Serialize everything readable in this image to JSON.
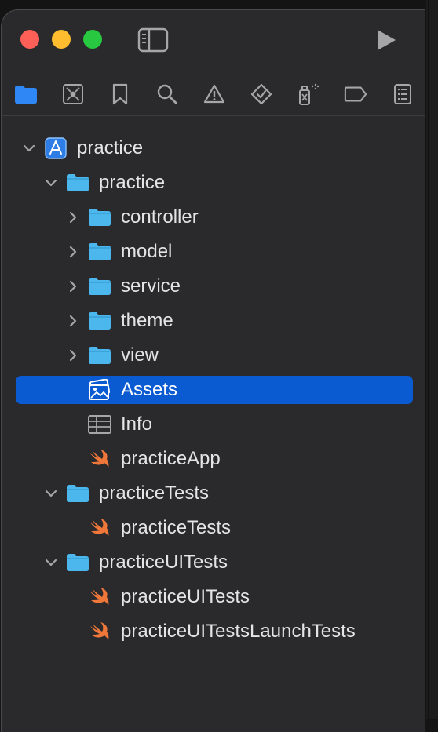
{
  "colors": {
    "accent": "#0a5ad1",
    "folder": "#4bb7ec",
    "swift": "#f0773a",
    "text": "#e4e4e6",
    "icon": "#a6a6a8",
    "close": "#fe5f57",
    "minimize": "#febc2e",
    "zoom": "#28c840"
  },
  "titlebar": {
    "icons": [
      "sidebar-toggle-icon",
      "run-play-icon"
    ]
  },
  "navigator_tabs": [
    {
      "icon": "folder-icon",
      "active": true
    },
    {
      "icon": "source-control-icon"
    },
    {
      "icon": "bookmark-icon"
    },
    {
      "icon": "search-icon"
    },
    {
      "icon": "warning-icon"
    },
    {
      "icon": "test-diamond-icon"
    },
    {
      "icon": "debug-spray-icon"
    },
    {
      "icon": "breakpoint-tag-icon"
    },
    {
      "icon": "report-list-icon"
    }
  ],
  "tree": [
    {
      "label": "practice",
      "type": "project",
      "depth": 0,
      "expanded": true
    },
    {
      "label": "practice",
      "type": "folder",
      "depth": 1,
      "expanded": true
    },
    {
      "label": "controller",
      "type": "folder",
      "depth": 2,
      "expanded": false
    },
    {
      "label": "model",
      "type": "folder",
      "depth": 2,
      "expanded": false
    },
    {
      "label": "service",
      "type": "folder",
      "depth": 2,
      "expanded": false
    },
    {
      "label": "theme",
      "type": "folder",
      "depth": 2,
      "expanded": false
    },
    {
      "label": "view",
      "type": "folder",
      "depth": 2,
      "expanded": false
    },
    {
      "label": "Assets",
      "type": "assets",
      "depth": 2,
      "selected": true
    },
    {
      "label": "Info",
      "type": "plist",
      "depth": 2
    },
    {
      "label": "practiceApp",
      "type": "swift",
      "depth": 2
    },
    {
      "label": "practiceTests",
      "type": "folder",
      "depth": 1,
      "expanded": true
    },
    {
      "label": "practiceTests",
      "type": "swift",
      "depth": 2
    },
    {
      "label": "practiceUITests",
      "type": "folder",
      "depth": 1,
      "expanded": true
    },
    {
      "label": "practiceUITests",
      "type": "swift",
      "depth": 2
    },
    {
      "label": "practiceUITestsLaunchTests",
      "type": "swift",
      "depth": 2
    }
  ]
}
